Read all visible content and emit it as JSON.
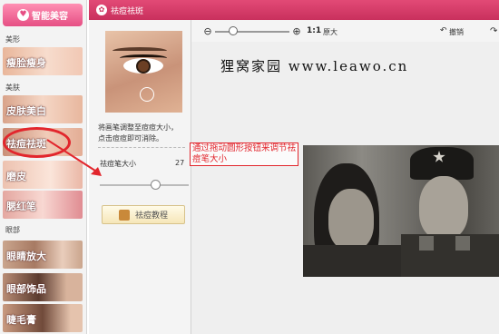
{
  "sidebar": {
    "smart_button": "智能美容",
    "sections": {
      "shape": "美形",
      "skin": "美肤",
      "eyes": "眼部"
    },
    "items": [
      {
        "label": "瘦脸瘦身"
      },
      {
        "label": "皮肤美白"
      },
      {
        "label": "祛痘祛斑"
      },
      {
        "label": "磨皮"
      },
      {
        "label": "腮红笔"
      },
      {
        "label": "眼睛放大"
      },
      {
        "label": "眼部饰品"
      },
      {
        "label": "睫毛膏"
      }
    ],
    "selected": "祛痘祛斑"
  },
  "window": {
    "title": "祛痘祛斑",
    "tool_panel": {
      "tip_line1": "将画笔调整至痘痘大小，",
      "tip_line2": "点击痘痘即可消除。",
      "brush_size_label": "祛痘笔大小",
      "brush_size_value": "27",
      "tutorial_button": "祛痘教程"
    },
    "toolbar": {
      "ratio": "1:1",
      "original_size": "原大",
      "undo": "撤销"
    },
    "watermark": "狸窝家园  www.leawo.cn",
    "annotation": "通过拖动圆形按钮来调节祛痘笔大小"
  },
  "colors": {
    "accent_pink": "#e24a76",
    "annotation_red": "#e2262d"
  },
  "icons": [
    "smart-beauty-icon",
    "app-logo-icon",
    "zoom-out-icon",
    "zoom-in-icon",
    "tutorial-icon",
    "redo-icon"
  ]
}
